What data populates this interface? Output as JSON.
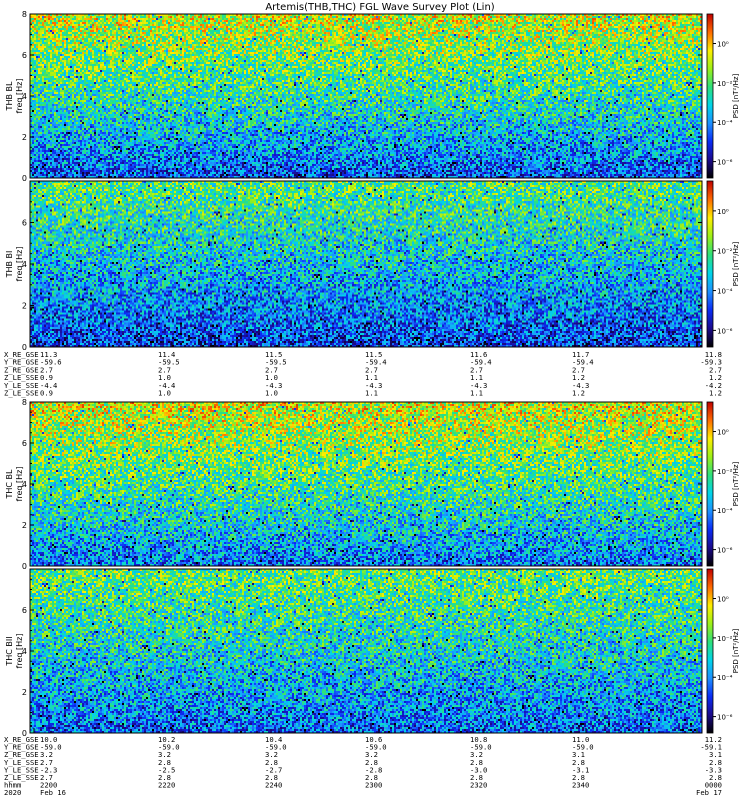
{
  "title": "Artemis(THB,THC) FGL Wave Survey Plot (Lin)",
  "colors": {
    "background": "#ffffff",
    "colormap": [
      "#000000",
      "#1c0a8c",
      "#0a2cf5",
      "#1e90ff",
      "#00d5e8",
      "#2ee07a",
      "#9ef017",
      "#ffee00",
      "#ff6a00",
      "#c00000"
    ]
  },
  "chart_data": [
    {
      "type": "heatmap",
      "panel_label": "THB BL",
      "ylabel": "freq [Hz]",
      "ylim": [
        0,
        8
      ],
      "yticks": [
        "0",
        "2",
        "4",
        "6",
        "8"
      ],
      "colorbar": {
        "label": "PSD [nT²/Hz]",
        "scale": "log",
        "tick_labels": [
          "10⁰",
          "10⁻²",
          "10⁻⁴",
          "10⁻⁶"
        ]
      },
      "intensity_profile": {
        "low_freq": 0.25,
        "high_freq": 0.72
      }
    },
    {
      "type": "heatmap",
      "panel_label": "THB BI",
      "ylabel": "freq [Hz]",
      "ylim": [
        0,
        8
      ],
      "yticks": [
        "0",
        "2",
        "4",
        "6"
      ],
      "colorbar": {
        "label": "PSD [nT²/Hz]",
        "scale": "log",
        "tick_labels": [
          "10⁰",
          "10⁻²",
          "10⁻⁴",
          "10⁻⁶"
        ]
      },
      "intensity_profile": {
        "low_freq": 0.22,
        "high_freq": 0.58
      }
    },
    {
      "type": "heatmap",
      "panel_label": "THC BL",
      "ylabel": "freq [Hz]",
      "ylim": [
        0,
        8
      ],
      "yticks": [
        "0",
        "2",
        "4",
        "6",
        "8"
      ],
      "colorbar": {
        "label": "PSD [nT²/Hz]",
        "scale": "log",
        "tick_labels": [
          "10⁰",
          "10⁻²",
          "10⁻⁴",
          "10⁻⁶"
        ]
      },
      "intensity_profile": {
        "low_freq": 0.3,
        "high_freq": 0.74
      }
    },
    {
      "type": "heatmap",
      "panel_label": "THC BII",
      "ylabel": "freq [Hz]",
      "ylim": [
        0,
        8
      ],
      "yticks": [
        "0",
        "2",
        "4",
        "6"
      ],
      "colorbar": {
        "label": "PSD [nT²/Hz]",
        "scale": "log",
        "tick_labels": [
          "10⁰",
          "10⁻²",
          "10⁻⁴",
          "10⁻⁶"
        ]
      },
      "intensity_profile": {
        "low_freq": 0.28,
        "high_freq": 0.6
      }
    }
  ],
  "ephemeris": [
    {
      "labels": [
        "X_RE_GSE",
        "Y_RE_GSE",
        "Z_RE_GSE",
        "Z_LE_SSE",
        "Y_LE_SSE",
        "Z_LE_SSE"
      ],
      "columns": [
        [
          "11.3",
          "-59.6",
          "2.7",
          "0.9",
          "-4.4",
          "0.9"
        ],
        [
          "11.4",
          "-59.5",
          "2.7",
          "1.0",
          "-4.4",
          "1.0"
        ],
        [
          "11.5",
          "-59.5",
          "2.7",
          "1.0",
          "-4.3",
          "1.0"
        ],
        [
          "11.5",
          "-59.4",
          "2.7",
          "1.1",
          "-4.3",
          "1.1"
        ],
        [
          "11.6",
          "-59.4",
          "2.7",
          "1.1",
          "-4.3",
          "1.1"
        ],
        [
          "11.7",
          "-59.4",
          "2.7",
          "1.2",
          "-4.3",
          "1.2"
        ],
        [
          "11.8",
          "-59.3",
          "2.7",
          "1.2",
          "-4.2",
          "1.2"
        ]
      ]
    },
    {
      "labels": [
        "X_RE_GSE",
        "Y_RE_GSE",
        "Z_RE_GSE",
        "Y_LE_SSE",
        "Y_LE_SSE",
        "Z_LE_SSE",
        "hhmm",
        "2020"
      ],
      "columns": [
        [
          "10.0",
          "-59.0",
          "3.2",
          "2.7",
          "-2.3",
          "2.7",
          "2200",
          "Feb 16"
        ],
        [
          "10.2",
          "-59.0",
          "3.2",
          "2.8",
          "-2.5",
          "2.8",
          "2220",
          ""
        ],
        [
          "10.4",
          "-59.0",
          "3.2",
          "2.8",
          "-2.7",
          "2.8",
          "2240",
          ""
        ],
        [
          "10.6",
          "-59.0",
          "3.2",
          "2.8",
          "-2.8",
          "2.8",
          "2300",
          ""
        ],
        [
          "10.8",
          "-59.0",
          "3.2",
          "2.8",
          "-3.0",
          "2.8",
          "2320",
          ""
        ],
        [
          "11.0",
          "-59.0",
          "3.1",
          "2.8",
          "-3.1",
          "2.8",
          "2340",
          ""
        ],
        [
          "11.2",
          "-59.1",
          "3.1",
          "2.8",
          "-3.3",
          "2.8",
          "0000",
          "Feb 17"
        ]
      ]
    }
  ]
}
